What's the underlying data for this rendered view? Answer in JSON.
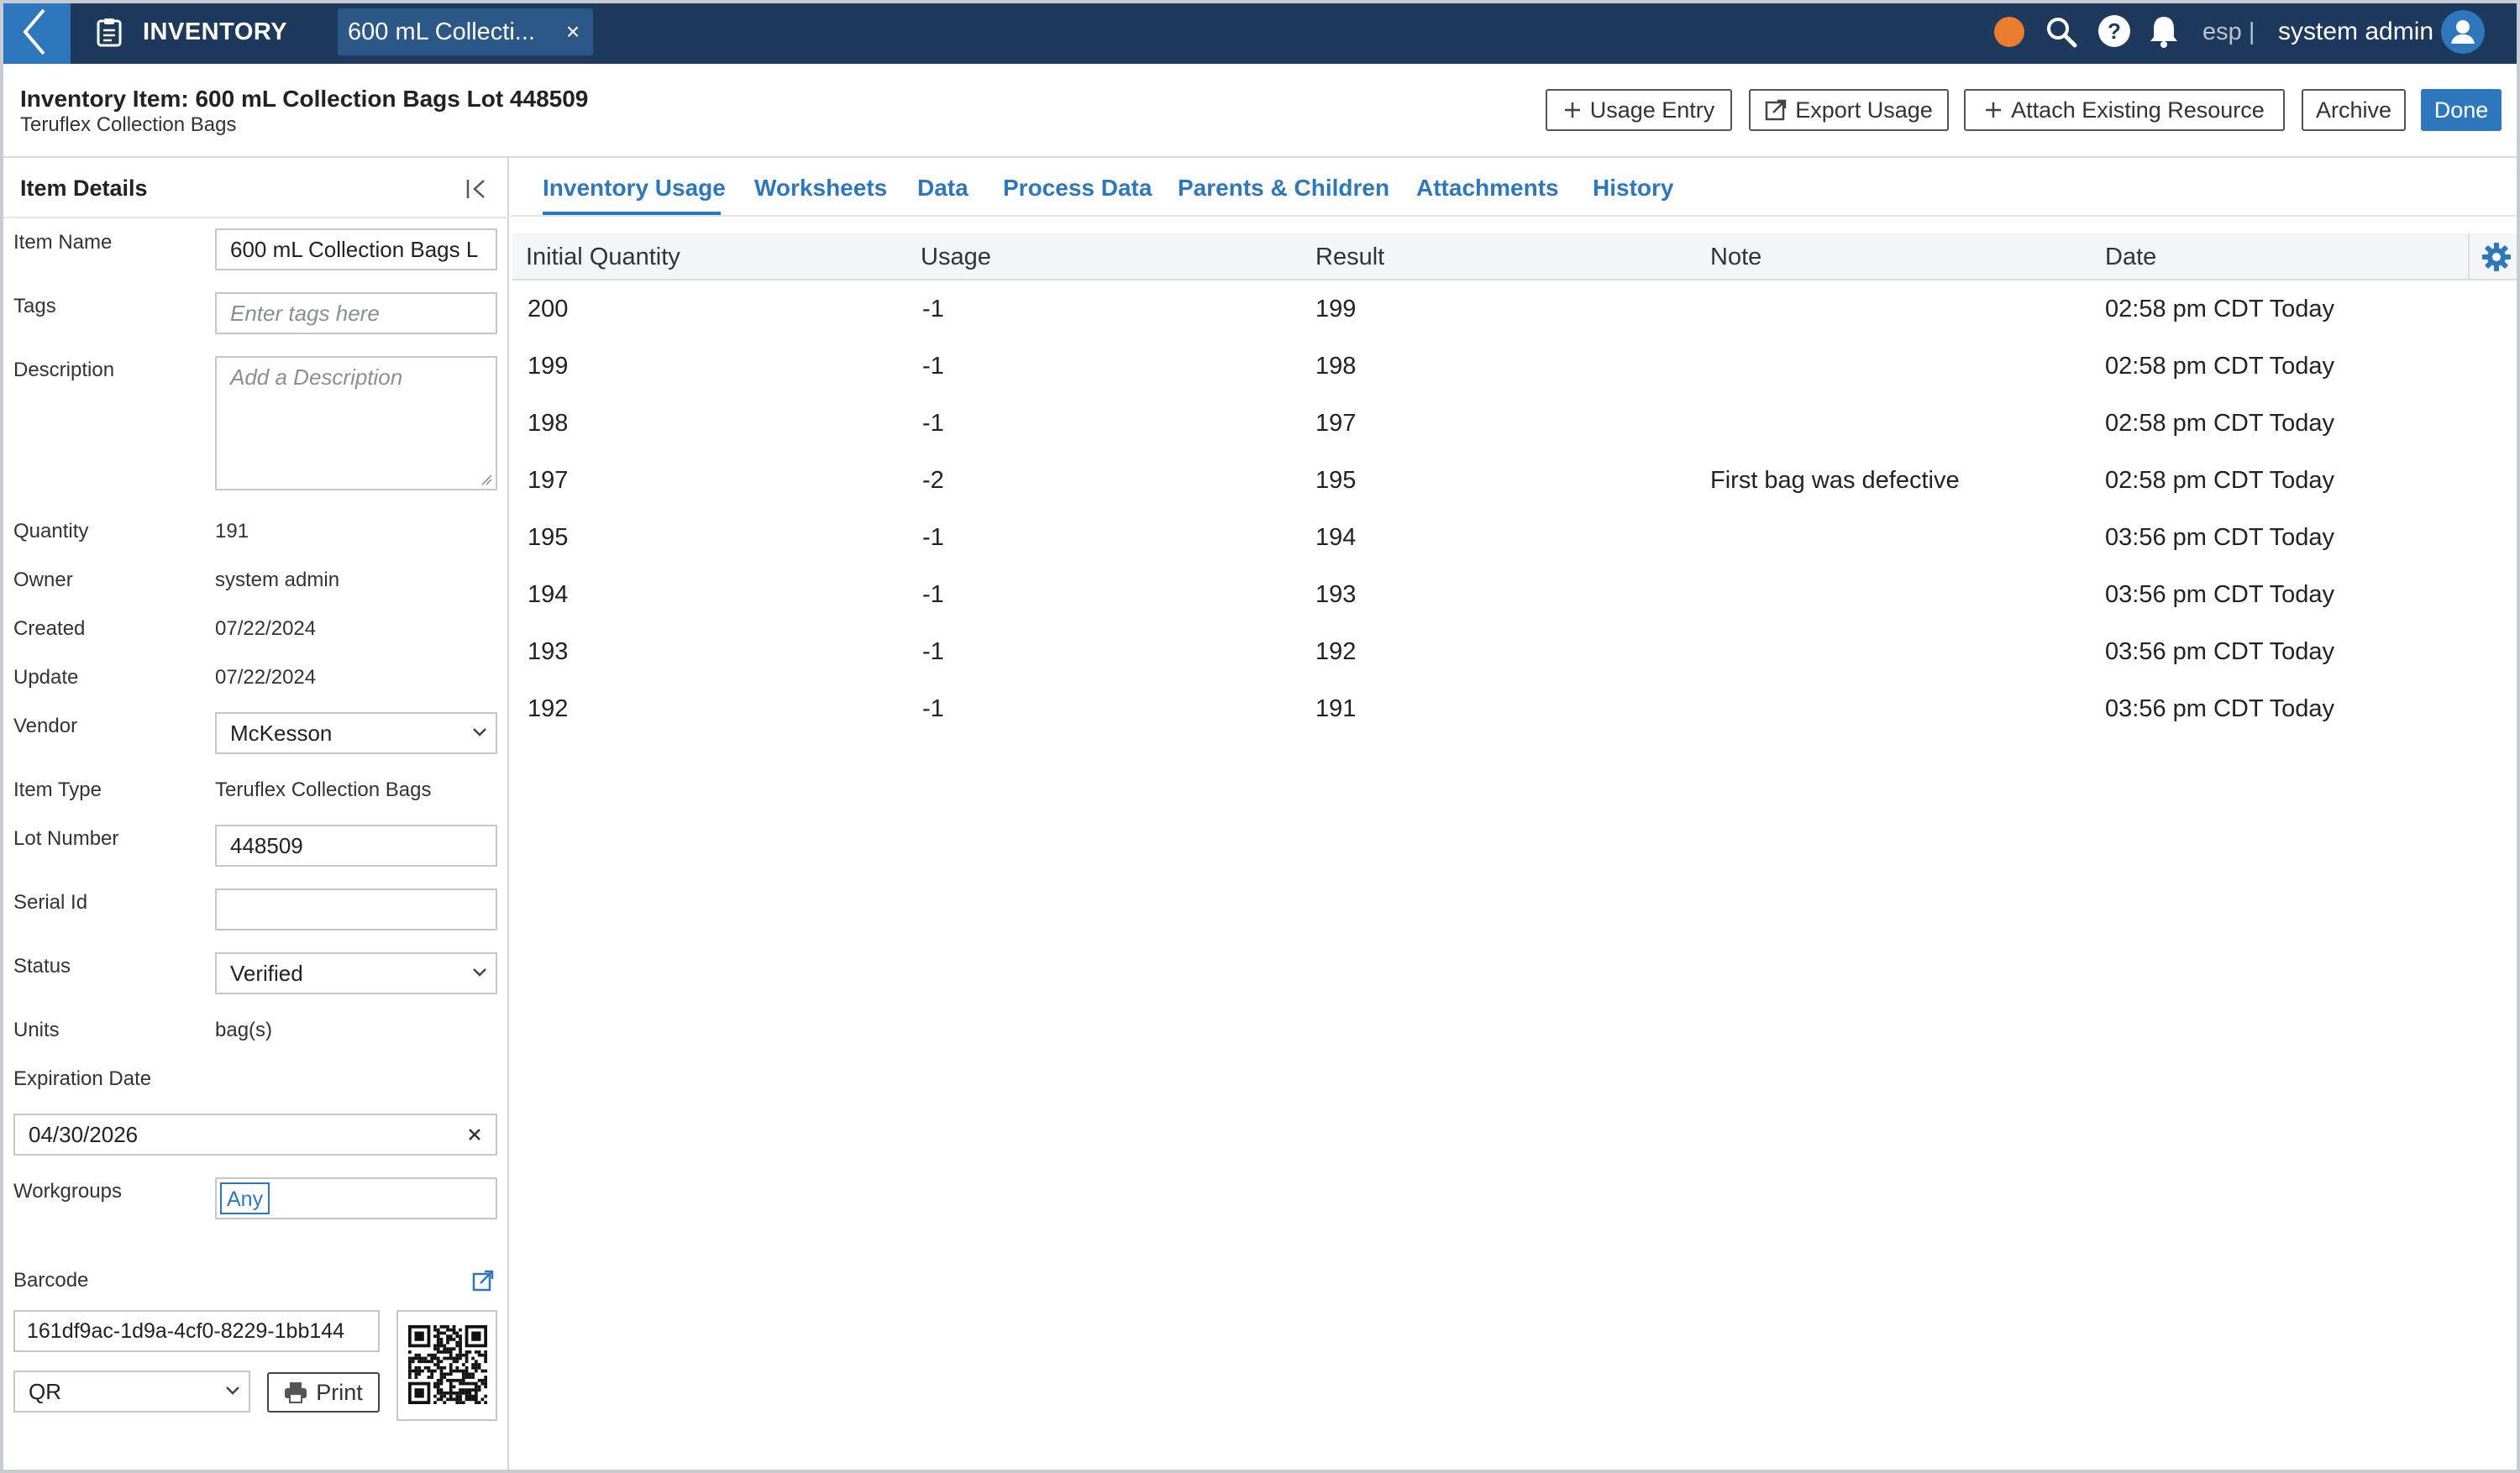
{
  "topbar": {
    "app_name": "INVENTORY",
    "tab_label": "600 mL Collecti...",
    "tab_close": "×",
    "lang": "esp |",
    "user": "system admin"
  },
  "header": {
    "title": "Inventory Item: 600 mL Collection Bags Lot 448509",
    "subtitle": "Teruflex Collection Bags",
    "buttons": {
      "usage_entry": "Usage Entry",
      "export_usage": "Export Usage",
      "attach": "Attach Existing Resource",
      "archive": "Archive",
      "done": "Done"
    }
  },
  "sidebar": {
    "title": "Item Details",
    "labels": {
      "item_name": "Item Name",
      "tags": "Tags",
      "description": "Description",
      "quantity": "Quantity",
      "owner": "Owner",
      "created": "Created",
      "update": "Update",
      "vendor": "Vendor",
      "item_type": "Item Type",
      "lot_number": "Lot Number",
      "serial_id": "Serial Id",
      "status": "Status",
      "units": "Units",
      "expiration": "Expiration Date",
      "workgroups": "Workgroups",
      "barcode": "Barcode"
    },
    "values": {
      "item_name": "600 mL Collection Bags L",
      "tags_placeholder": "Enter tags here",
      "description_placeholder": "Add a Description",
      "quantity": "191",
      "owner": "system admin",
      "created": "07/22/2024",
      "update": "07/22/2024",
      "vendor": "McKesson",
      "item_type": "Teruflex Collection Bags",
      "lot_number": "448509",
      "serial_id": "",
      "status": "Verified",
      "units": "bag(s)",
      "expiration": "04/30/2026",
      "workgroup_tag": "Any",
      "barcode": "161df9ac-1d9a-4cf0-8229-1bb144",
      "barcode_type": "QR",
      "print": "Print"
    }
  },
  "tabs": [
    "Inventory Usage",
    "Worksheets",
    "Data",
    "Process Data",
    "Parents & Children",
    "Attachments",
    "History"
  ],
  "table": {
    "columns": [
      "Initial Quantity",
      "Usage",
      "Result",
      "Note",
      "Date"
    ],
    "rows": [
      [
        "200",
        "-1",
        "199",
        "",
        "02:58 pm CDT Today"
      ],
      [
        "199",
        "-1",
        "198",
        "",
        "02:58 pm CDT Today"
      ],
      [
        "198",
        "-1",
        "197",
        "",
        "02:58 pm CDT Today"
      ],
      [
        "197",
        "-2",
        "195",
        "First bag was defective",
        "02:58 pm CDT Today"
      ],
      [
        "195",
        "-1",
        "194",
        "",
        "03:56 pm CDT Today"
      ],
      [
        "194",
        "-1",
        "193",
        "",
        "03:56 pm CDT Today"
      ],
      [
        "193",
        "-1",
        "192",
        "",
        "03:56 pm CDT Today"
      ],
      [
        "192",
        "-1",
        "191",
        "",
        "03:56 pm CDT Today"
      ]
    ]
  },
  "colors": {
    "topbar": "#1d3a5c",
    "accent": "#2f77bd",
    "status_dot": "#ea7d30"
  }
}
